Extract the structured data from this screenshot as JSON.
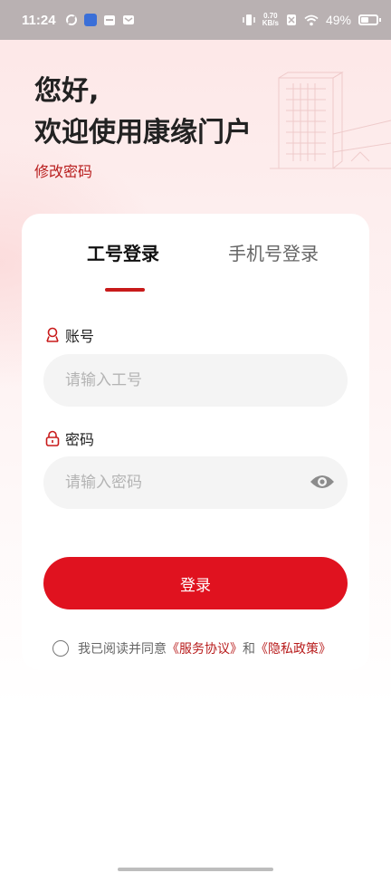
{
  "status_bar": {
    "time": "11:24",
    "network_speed_value": "0.70",
    "network_speed_unit": "KB/s",
    "battery_percent": "49%",
    "battery_level": 0.49
  },
  "header": {
    "greeting_line1": "您好,",
    "greeting_line2": "欢迎使用康缘门户",
    "change_password": "修改密码"
  },
  "tabs": [
    {
      "label": "工号登录",
      "active": true
    },
    {
      "label": "手机号登录",
      "active": false
    }
  ],
  "form": {
    "account_label": "账号",
    "account_placeholder": "请输入工号",
    "password_label": "密码",
    "password_placeholder": "请输入密码",
    "login_label": "登录"
  },
  "agreement": {
    "prefix": "我已阅读并同意",
    "service": "《服务协议》",
    "and": "和",
    "privacy": "《隐私政策》"
  },
  "colors": {
    "accent": "#e0121f",
    "link": "#b81c1c",
    "statusbar": "#b9b1b2"
  }
}
